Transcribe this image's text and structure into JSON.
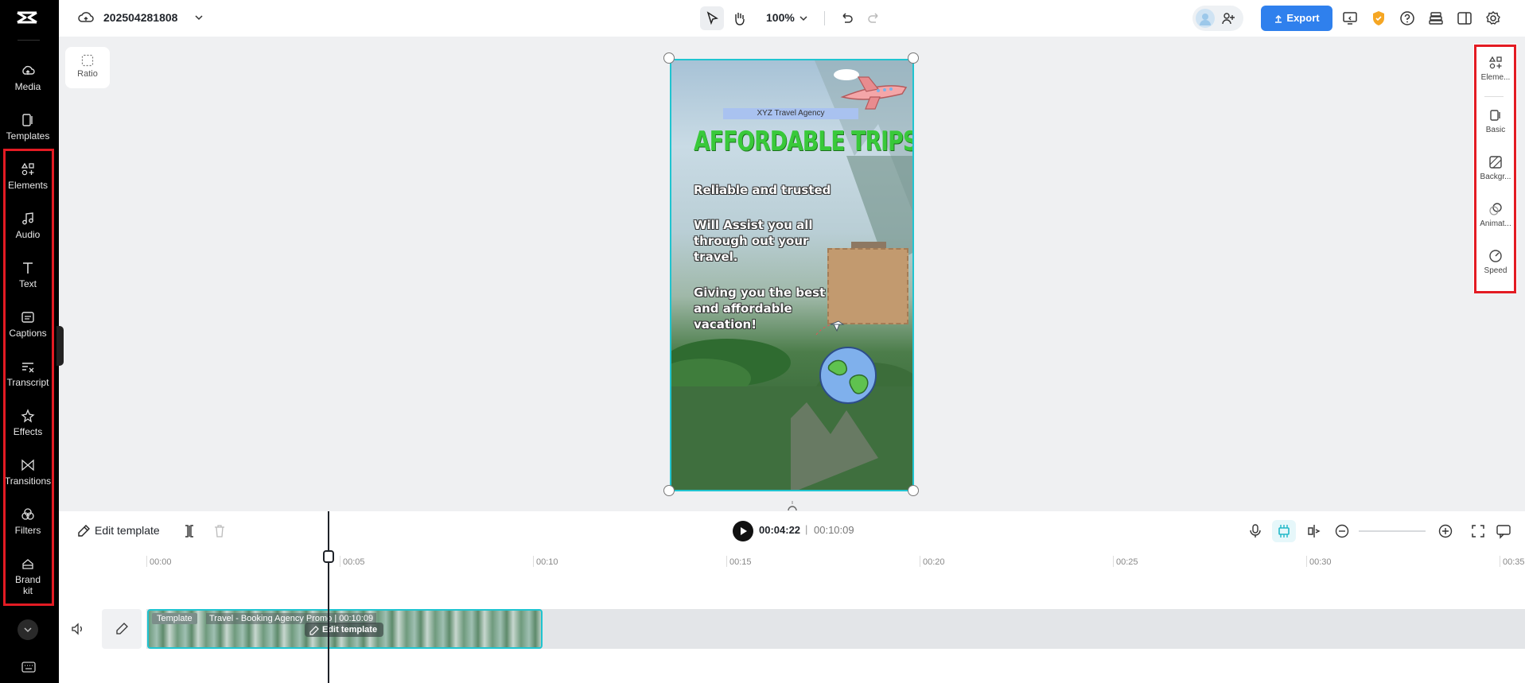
{
  "app": {
    "logo": "capcut-logo",
    "project_name": "202504281808"
  },
  "topbar": {
    "zoom": "100%",
    "export_label": "Export",
    "accent": "#2f80ed"
  },
  "sidebar": {
    "items": [
      {
        "label": "Media",
        "icon": "cloud-upload-icon"
      },
      {
        "label": "Templates",
        "icon": "templates-icon"
      },
      {
        "label": "Elements",
        "icon": "elements-icon"
      },
      {
        "label": "Audio",
        "icon": "music-note-icon"
      },
      {
        "label": "Text",
        "icon": "text-icon"
      },
      {
        "label": "Captions",
        "icon": "captions-icon"
      },
      {
        "label": "Transcript",
        "icon": "transcript-icon"
      },
      {
        "label": "Effects",
        "icon": "effects-icon"
      },
      {
        "label": "Transitions",
        "icon": "transitions-icon"
      },
      {
        "label": "Filters",
        "icon": "filters-icon"
      },
      {
        "label": "Brand kit",
        "line1": "Brand",
        "line2": "kit",
        "icon": "brand-kit-icon"
      }
    ]
  },
  "ratio": {
    "label": "Ratio"
  },
  "canvas": {
    "agency": "XYZ Travel Agency",
    "headline": "AFFORDABLE TRIPS",
    "line1": "Reliable and trusted",
    "line2a": "Will Assist you all",
    "line2b": "through out your",
    "line2c": "travel.",
    "line3a": "Giving you the best",
    "line3b": "and affordable",
    "line3c": "vacation!"
  },
  "right_panel": {
    "items": [
      {
        "label": "Eleme...",
        "icon": "elements-icon"
      },
      {
        "label": "Basic",
        "icon": "basic-icon"
      },
      {
        "label": "Backgr...",
        "icon": "background-icon"
      },
      {
        "label": "Animat...",
        "icon": "animation-icon"
      },
      {
        "label": "Speed",
        "icon": "speed-icon"
      }
    ]
  },
  "timeline": {
    "edit_template_label": "Edit template",
    "current_time": "00:04:22",
    "separator": "|",
    "total_time": "00:10:09",
    "ruler": [
      "00:00",
      "00:05",
      "00:10",
      "00:15",
      "00:20",
      "00:25",
      "00:30",
      "00:35"
    ],
    "clip": {
      "tag": "Template",
      "title": "Travel - Booking Agency Promo",
      "duration": "00:10:09",
      "edit_label": "Edit template"
    }
  },
  "highlight_color": "#e31b23"
}
